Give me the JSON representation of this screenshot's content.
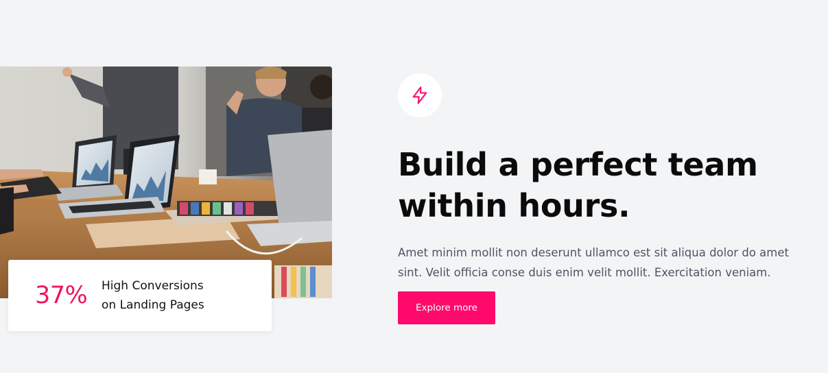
{
  "photo": {
    "subject": "team-meeting-photo"
  },
  "stat": {
    "value": "37%",
    "label_line1": "High Conversions",
    "label_line2": "on Landing Pages"
  },
  "feature": {
    "icon": "lightning-bolt-icon",
    "heading_line1": "Build a perfect team",
    "heading_line2": "within hours.",
    "description_line1": "Amet minim mollit non deserunt ullamco est sit aliqua dolor do amet",
    "description_line2": "sint. Velit officia conse duis enim velit mollit. Exercitation veniam.",
    "cta_label": "Explore more"
  },
  "colors": {
    "background": "#f3f4f6",
    "accent": "#ff0a6c",
    "stat_accent": "#f0145f",
    "heading": "#0b0b0b",
    "body_text": "#4b5563"
  }
}
